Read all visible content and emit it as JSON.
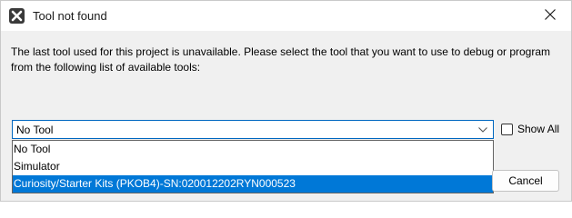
{
  "dialog": {
    "title": "Tool not found",
    "message": "The last tool used for this project is unavailable.  Please select the tool that you want to use to debug or program from the following list of available tools:"
  },
  "tool_select": {
    "selected": "No Tool",
    "options": [
      "No Tool",
      "Simulator",
      "Curiosity/Starter Kits (PKOB4)-SN:020012202RYN000523"
    ],
    "highlighted_index": 2
  },
  "show_all": {
    "label": "Show All",
    "checked": false
  },
  "buttons": {
    "cancel": "Cancel"
  },
  "colors": {
    "accent": "#0078d7",
    "focus_border": "#0067c0"
  }
}
